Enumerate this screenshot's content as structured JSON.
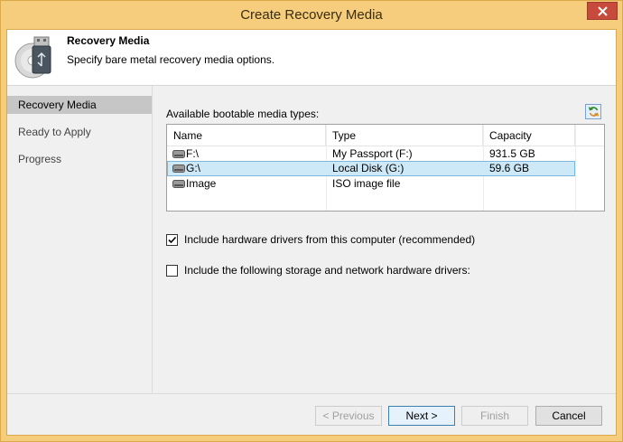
{
  "window": {
    "title": "Create Recovery Media"
  },
  "header": {
    "title": "Recovery Media",
    "subtitle": "Specify bare metal recovery media options."
  },
  "nav": {
    "items": [
      {
        "label": "Recovery Media",
        "active": true
      },
      {
        "label": "Ready to Apply",
        "active": false
      },
      {
        "label": "Progress",
        "active": false
      }
    ]
  },
  "media": {
    "label": "Available bootable media types:",
    "columns": [
      "Name",
      "Type",
      "Capacity"
    ],
    "rows": [
      {
        "name": "F:\\",
        "type": "My Passport (F:)",
        "capacity": "931.5 GB",
        "selected": false
      },
      {
        "name": "G:\\",
        "type": "Local Disk (G:)",
        "capacity": "59.6 GB",
        "selected": true
      },
      {
        "name": "Image",
        "type": "ISO image file",
        "capacity": "",
        "selected": false
      }
    ]
  },
  "options": {
    "include_drivers": {
      "label": "Include hardware drivers from this computer (recommended)",
      "checked": true
    },
    "include_storage": {
      "label": "Include the following storage and network hardware drivers:",
      "checked": false
    }
  },
  "buttons": {
    "previous": "< Previous",
    "next": "Next >",
    "finish": "Finish",
    "cancel": "Cancel"
  },
  "icons": {
    "close": "close-icon",
    "refresh": "refresh-icon",
    "drive": "drive-icon",
    "header": "usb-disc-icon"
  }
}
